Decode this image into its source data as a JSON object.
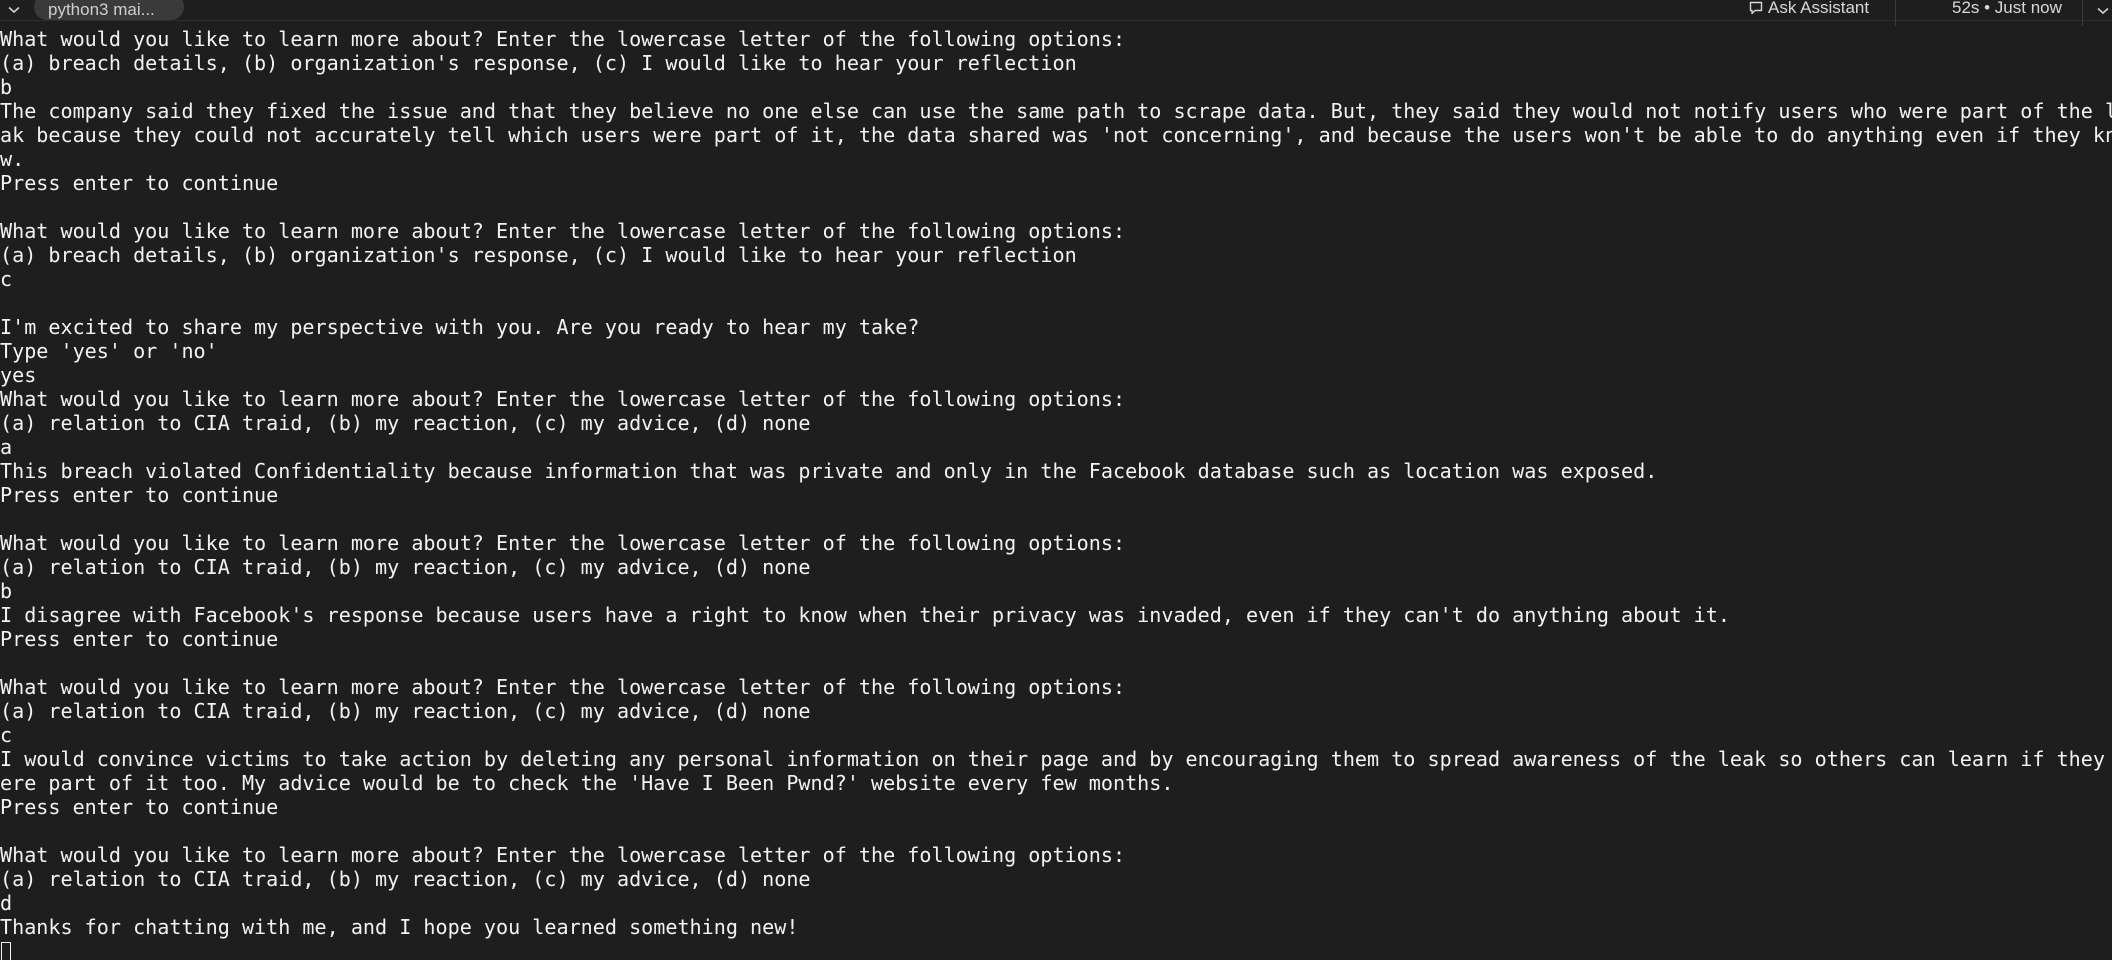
{
  "header": {
    "tab_title": "python3 mai...",
    "ask_assistant_label": "Ask Assistant",
    "status": "52s • Just now"
  },
  "terminal": {
    "lines": [
      "What would you like to learn more about? Enter the lowercase letter of the following options:",
      "(a) breach details, (b) organization's response, (c) I would like to hear your reflection",
      "b",
      "The company said they fixed the issue and that they believe no one else can use the same path to scrape data. But, they said they would not notify users who were part of the le",
      "ak because they could not accurately tell which users were part of it, the data shared was 'not concerning', and because the users won't be able to do anything even if they kne",
      "w.",
      "Press enter to continue",
      "",
      "What would you like to learn more about? Enter the lowercase letter of the following options:",
      "(a) breach details, (b) organization's response, (c) I would like to hear your reflection",
      "c",
      "",
      "I'm excited to share my perspective with you. Are you ready to hear my take?",
      "Type 'yes' or 'no'",
      "yes",
      "What would you like to learn more about? Enter the lowercase letter of the following options:",
      "(a) relation to CIA traid, (b) my reaction, (c) my advice, (d) none",
      "a",
      "This breach violated Confidentiality because information that was private and only in the Facebook database such as location was exposed.",
      "Press enter to continue",
      "",
      "What would you like to learn more about? Enter the lowercase letter of the following options:",
      "(a) relation to CIA traid, (b) my reaction, (c) my advice, (d) none",
      "b",
      "I disagree with Facebook's response because users have a right to know when their privacy was invaded, even if they can't do anything about it.",
      "Press enter to continue",
      "",
      "What would you like to learn more about? Enter the lowercase letter of the following options:",
      "(a) relation to CIA traid, (b) my reaction, (c) my advice, (d) none",
      "c",
      "I would convince victims to take action by deleting any personal information on their page and by encouraging them to spread awareness of the leak so others can learn if they w",
      "ere part of it too. My advice would be to check the 'Have I Been Pwnd?' website every few months.",
      "Press enter to continue",
      "",
      "What would you like to learn more about? Enter the lowercase letter of the following options:",
      "(a) relation to CIA traid, (b) my reaction, (c) my advice, (d) none",
      "d",
      "Thanks for chatting with me, and I hope you learned something new!"
    ]
  },
  "icons": {
    "collapse": "chevron-down-icon",
    "assistant": "chat-bubble-icon",
    "menu": "chevron-down-icon"
  },
  "colors": {
    "background": "#1e1e1e",
    "text": "#f2f2f2",
    "tab_pill": "#3a3a3a"
  }
}
